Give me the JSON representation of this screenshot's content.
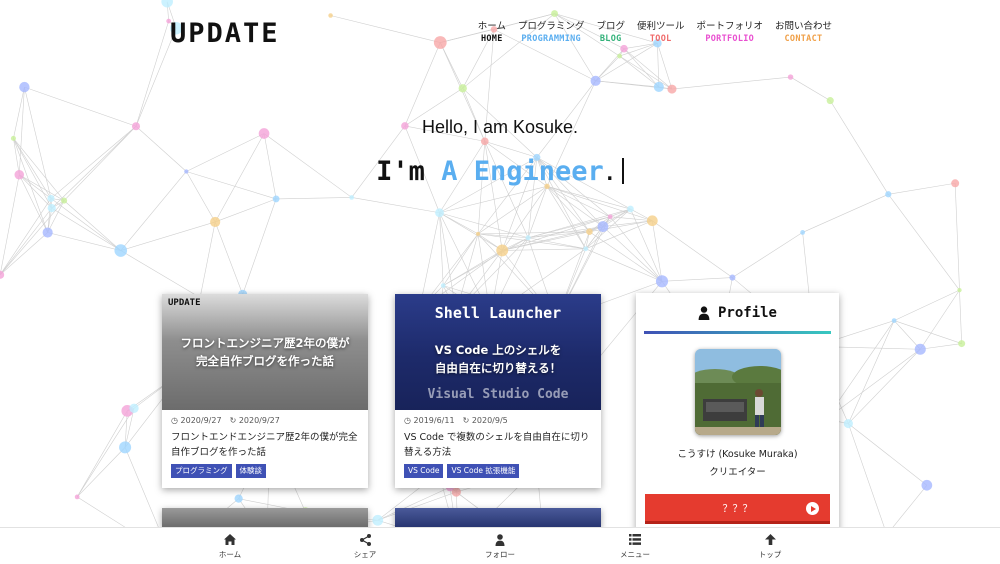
{
  "site": {
    "logo": "UPDATE"
  },
  "nav": [
    {
      "jp": "ホーム",
      "en": "HOME",
      "color": "#111111"
    },
    {
      "jp": "プログラミング",
      "en": "PROGRAMMING",
      "color": "#5aaef0"
    },
    {
      "jp": "ブログ",
      "en": "BLOG",
      "color": "#33b27a"
    },
    {
      "jp": "便利ツール",
      "en": "TOOL",
      "color": "#f06a6a"
    },
    {
      "jp": "ポートフォリオ",
      "en": "PORTFOLIO",
      "color": "#e94fd0"
    },
    {
      "jp": "お問い合わせ",
      "en": "CONTACT",
      "color": "#f0a048"
    }
  ],
  "hero": {
    "greeting": "Hello, I am Kosuke.",
    "prefix": "I'm ",
    "accent": "A Engineer",
    "suffix": "."
  },
  "cards": [
    {
      "thumb_logo": "UPDATE",
      "thumb_line1": "フロントエンジニア歴2年の僕が",
      "thumb_line2": "完全自作ブログを作った話",
      "published": "2020/9/27",
      "updated": "2020/9/27",
      "title": "フロントエンドエンジニア歴2年の僕が完全自作ブログを作った話",
      "tags": [
        "プログラミング",
        "体験談"
      ]
    },
    {
      "thumb_big": "Shell Launcher",
      "thumb_line1": "VS Code 上のシェルを",
      "thumb_line2": "自由自在に切り替える！",
      "thumb_sub": "Visual Studio Code",
      "published": "2019/6/11",
      "updated": "2020/9/5",
      "title": "VS Code で複数のシェルを自由自在に切り替える方法",
      "tags": [
        "VS Code",
        "VS Code 拡張機能"
      ]
    }
  ],
  "profile": {
    "heading": "Profile",
    "name": "こうすけ (Kosuke Muraka)",
    "role": "クリエイター",
    "button": "？？？"
  },
  "bottom_nav": [
    {
      "label": "ホーム",
      "icon": "home-icon"
    },
    {
      "label": "シェア",
      "icon": "share-icon"
    },
    {
      "label": "フォロー",
      "icon": "user-icon"
    },
    {
      "label": "メニュー",
      "icon": "list-icon"
    },
    {
      "label": "トップ",
      "icon": "arrow-up-icon"
    }
  ],
  "colors": {
    "accent_blue": "#5aaef0",
    "tag_blue": "#3f51b5",
    "profile_button_red": "#e53b2f"
  }
}
